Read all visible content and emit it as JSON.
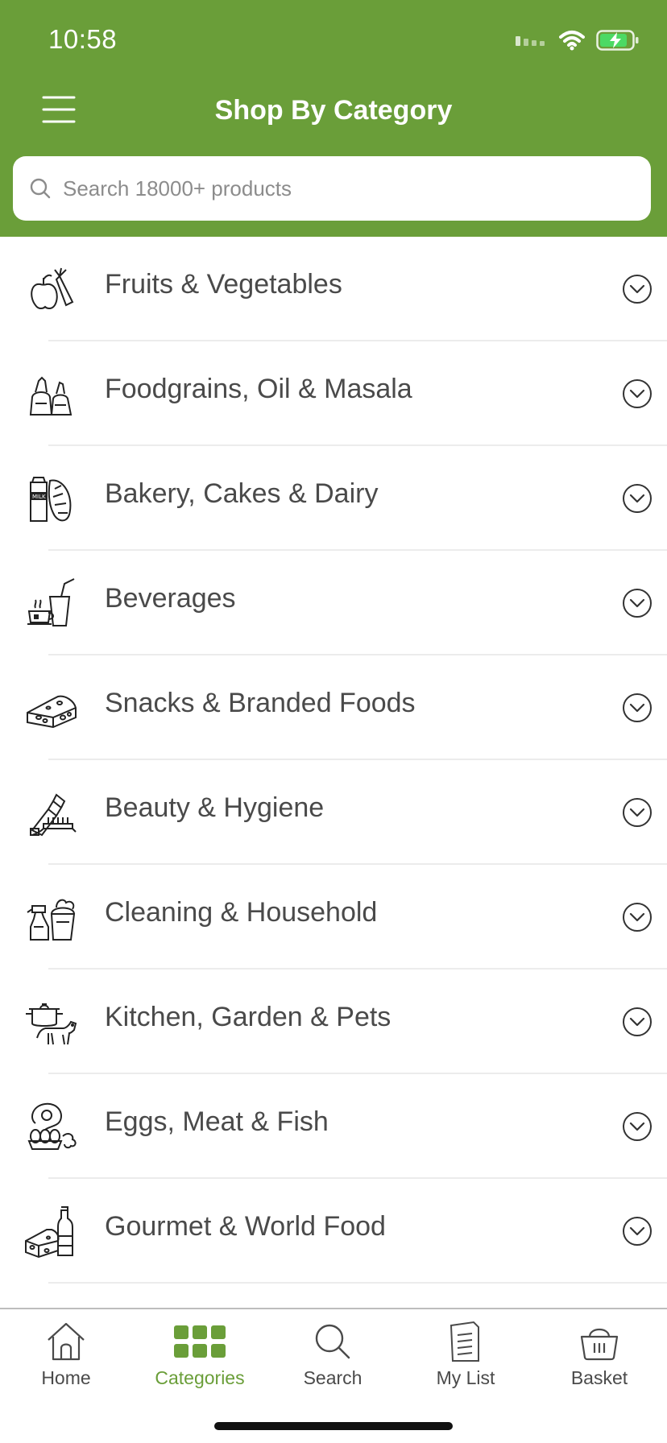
{
  "status": {
    "time": "10:58"
  },
  "header": {
    "title": "Shop By Category"
  },
  "search": {
    "placeholder": "Search 18000+ products"
  },
  "categories": [
    {
      "label": "Fruits & Vegetables",
      "icon": "fruits-vegetables-icon"
    },
    {
      "label": "Foodgrains, Oil & Masala",
      "icon": "foodgrains-icon"
    },
    {
      "label": "Bakery, Cakes & Dairy",
      "icon": "bakery-dairy-icon"
    },
    {
      "label": "Beverages",
      "icon": "beverages-icon"
    },
    {
      "label": "Snacks & Branded Foods",
      "icon": "snacks-icon"
    },
    {
      "label": "Beauty & Hygiene",
      "icon": "beauty-hygiene-icon"
    },
    {
      "label": "Cleaning & Household",
      "icon": "cleaning-icon"
    },
    {
      "label": "Kitchen, Garden & Pets",
      "icon": "kitchen-pets-icon"
    },
    {
      "label": "Eggs, Meat & Fish",
      "icon": "eggs-meat-icon"
    },
    {
      "label": "Gourmet & World Food",
      "icon": "gourmet-icon"
    }
  ],
  "tabbar": {
    "items": [
      {
        "label": "Home",
        "icon": "home-icon"
      },
      {
        "label": "Categories",
        "icon": "grid-icon",
        "active": true
      },
      {
        "label": "Search",
        "icon": "search-icon"
      },
      {
        "label": "My List",
        "icon": "list-icon"
      },
      {
        "label": "Basket",
        "icon": "basket-icon"
      }
    ]
  },
  "colors": {
    "brand_green": "#6a9e39",
    "text": "#4a4a4a",
    "divider": "#ececec"
  }
}
